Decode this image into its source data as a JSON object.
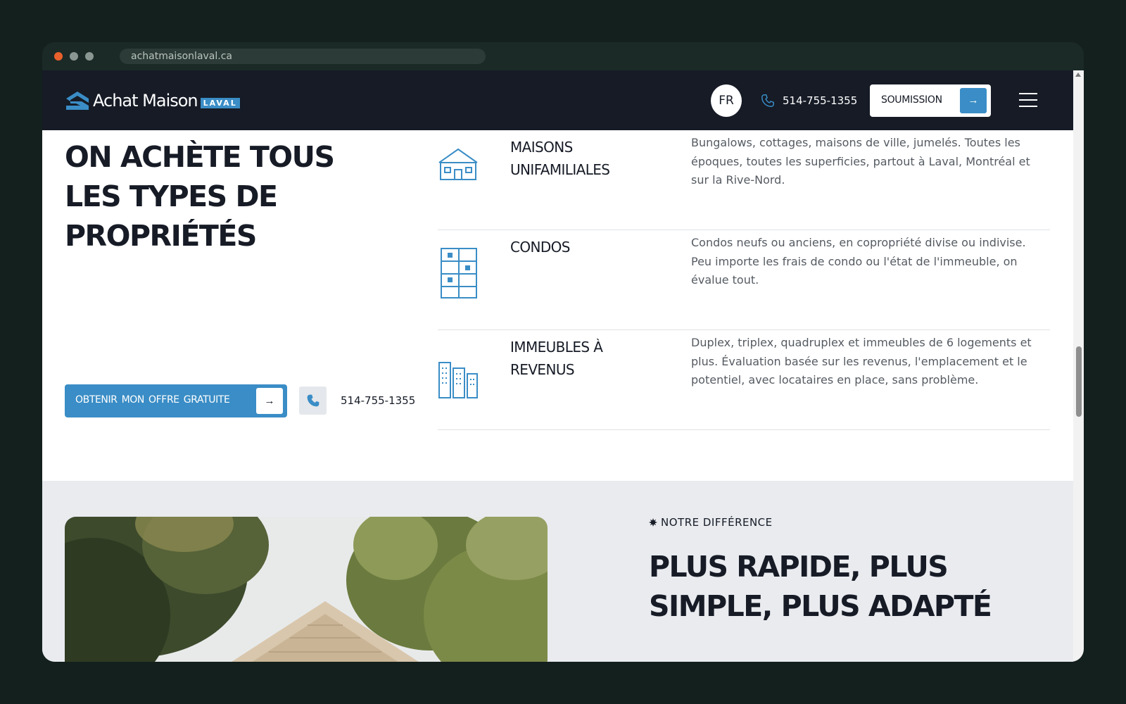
{
  "browser": {
    "url": "achatmaisonlaval.ca"
  },
  "header": {
    "logo_text": "Achat Maison",
    "logo_badge": "LAVAL",
    "lang": "FR",
    "phone": "514-755-1355",
    "cta_label": "SOUMISSION",
    "cta_icon": "arrow-right-icon",
    "menu_icon": "hamburger-icon"
  },
  "properties_section": {
    "title": "ON ACHÈTE TOUS LES TYPES DE PROPRIÉTÉS",
    "offer_button_label": "OBTENIR MON OFFRE  GRATUITE",
    "phone": "514-755-1355",
    "items": [
      {
        "icon": "house-icon",
        "name": "MAISONS UNIFAMILIALES",
        "description": "Bungalows, cottages, maisons de ville, jumelés. Toutes les époques, toutes les superficies, partout à Laval, Montréal et sur la Rive-Nord."
      },
      {
        "icon": "condo-building-icon",
        "name": "CONDOS",
        "description": "Condos neufs ou anciens, en copropriété divise ou indivise. Peu importe les frais de condo ou l'état de l'immeuble, on évalue tout."
      },
      {
        "icon": "buildings-icon",
        "name": "IMMEUBLES À REVENUS",
        "description": "Duplex, triplex, quadruplex et immeubles de 6 logements et plus. Évaluation basée sur les revenus, l'emplacement et le potentiel, avec locataires en place, sans problème."
      }
    ]
  },
  "difference_section": {
    "eyebrow": "NOTRE DIFFÉRENCE",
    "title": "PLUS RAPIDE, PLUS SIMPLE, PLUS ADAPTÉ"
  },
  "colors": {
    "navy": "#161b26",
    "accent_blue": "#3a8dc6",
    "muted_text": "#555b62",
    "section_gray": "#e9ebef"
  }
}
